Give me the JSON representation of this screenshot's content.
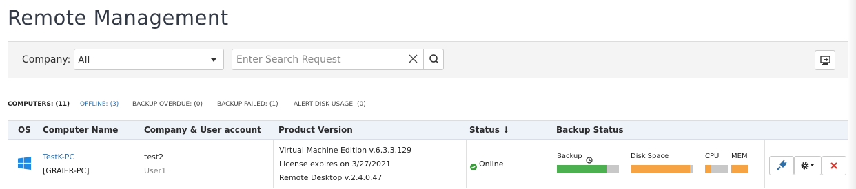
{
  "page": {
    "title": "Remote Management"
  },
  "filter": {
    "company_label": "Company:",
    "company_value": "All",
    "search_placeholder": "Enter Search Request"
  },
  "counters": [
    {
      "label": "COMPUTERS:",
      "count": "(11)"
    },
    {
      "label": "OFFLINE:",
      "count": "(3)"
    },
    {
      "label": "BACKUP OVERDUE:",
      "count": "(0)"
    },
    {
      "label": "BACKUP FAILED:",
      "count": "(1)"
    },
    {
      "label": "ALERT DISK USAGE:",
      "count": "(0)"
    }
  ],
  "table": {
    "headers": {
      "os": "OS",
      "computer_name": "Computer Name",
      "company_user": "Company & User account",
      "product_version": "Product Version",
      "status": "Status ↓",
      "backup_status": "Backup Status"
    },
    "rows": [
      {
        "os_icon": "windows-icon",
        "computer_name": "TestK-PC",
        "computer_alias": "[GRAIER-PC]",
        "company": "test2",
        "user": "User1",
        "product_lines": [
          "Virtual Machine Edition v.6.3.3.129",
          "License expires on 3/27/2021",
          "Remote Desktop v.2.4.0.47"
        ],
        "status": "Online",
        "backup": {
          "backup_label": "Backup",
          "backup_fraction": 0.8,
          "backup_color": "#4caf50",
          "disk_label": "Disk Space",
          "disk_fraction": 0.95,
          "disk_color": "#f5a343",
          "cpu_label": "CPU",
          "cpu_fraction": 0.25,
          "cpu_color": "#f5a343",
          "mem_label": "MEM",
          "mem_fraction": 1.0,
          "mem_color": "#f5a343"
        }
      }
    ]
  },
  "colors": {
    "link": "#2f6fa8",
    "online": "#3a9b3a",
    "delete": "#d9342b",
    "header_bg": "#eef3fa"
  }
}
